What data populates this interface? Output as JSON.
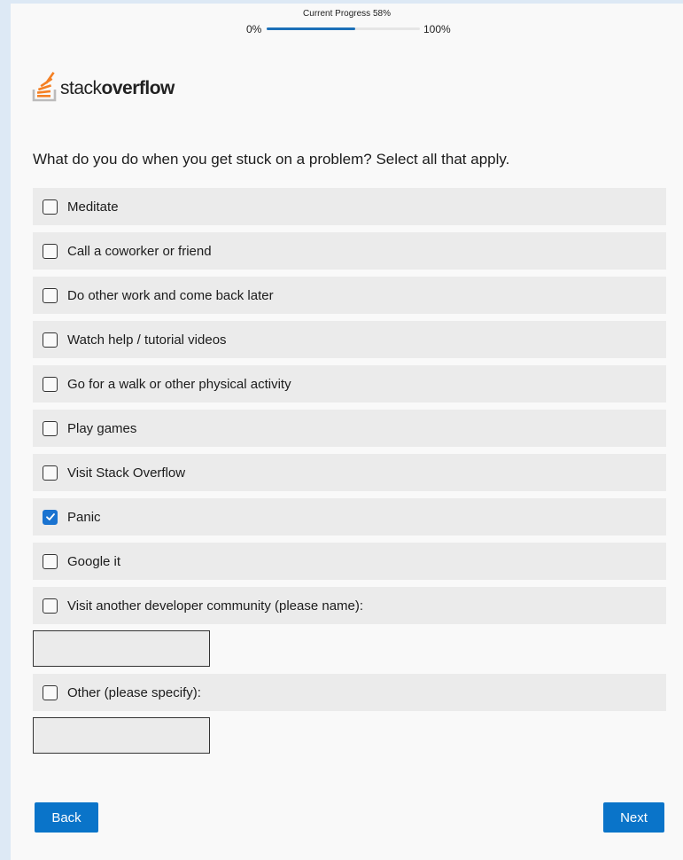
{
  "progress": {
    "caption": "Current Progress 58%",
    "min_label": "0%",
    "max_label": "100%",
    "value_percent": 58
  },
  "logo": {
    "text_light": "stack",
    "text_bold": "overflow",
    "colors": {
      "bars": "#f48024",
      "tray": "#bcbbbb"
    }
  },
  "question": "What do you do when you get stuck on a problem? Select all that apply.",
  "options": [
    {
      "label": "Meditate",
      "checked": false
    },
    {
      "label": "Call a coworker or friend",
      "checked": false
    },
    {
      "label": "Do other work and come back later",
      "checked": false
    },
    {
      "label": "Watch help / tutorial videos",
      "checked": false
    },
    {
      "label": "Go for a walk or other physical activity",
      "checked": false
    },
    {
      "label": "Play games",
      "checked": false
    },
    {
      "label": "Visit Stack Overflow",
      "checked": false
    },
    {
      "label": "Panic",
      "checked": true
    },
    {
      "label": "Google it",
      "checked": false
    },
    {
      "label": "Visit another developer community (please name):",
      "checked": false,
      "text_value": ""
    },
    {
      "label": "Other (please specify):",
      "checked": false,
      "text_value": ""
    }
  ],
  "buttons": {
    "back": "Back",
    "next": "Next"
  },
  "colors": {
    "accent": "#0a74c9",
    "checked": "#1a73d0",
    "option_bg": "#ebebeb",
    "page_bg": "#f9f9f9"
  }
}
